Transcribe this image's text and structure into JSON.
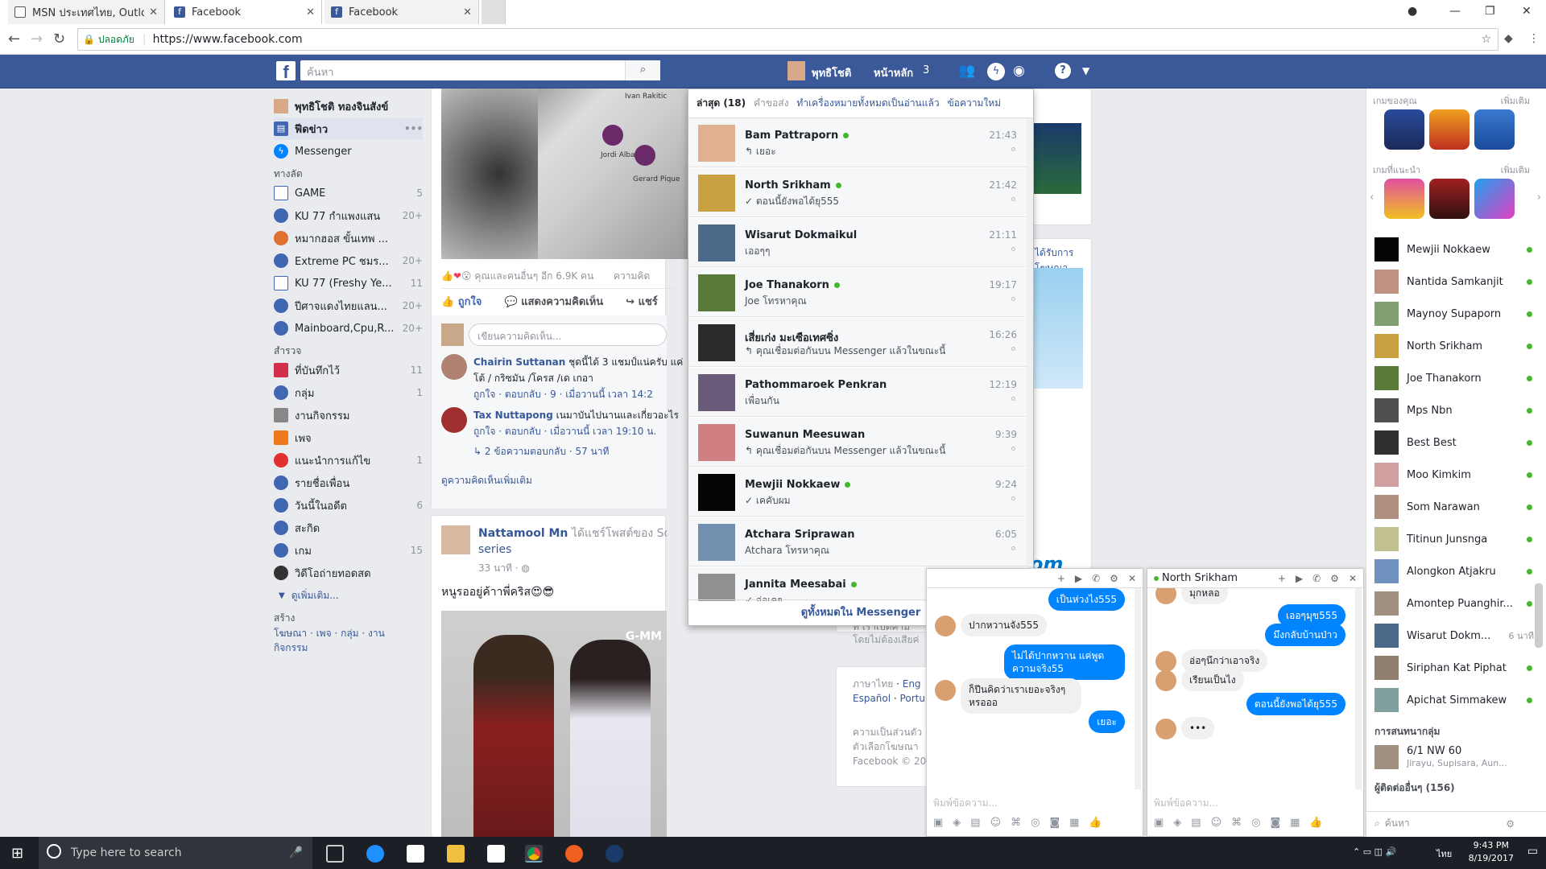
{
  "browser": {
    "tabs": [
      {
        "title": "MSN ประเทศไทย, Outlook",
        "active": false
      },
      {
        "title": "Facebook",
        "active": true
      },
      {
        "title": "Facebook",
        "active": false
      }
    ],
    "secure_label": "ปลอดภัย",
    "url": "https://www.facebook.com"
  },
  "fbbar": {
    "search_placeholder": "ค้นหา",
    "user_short": "พุทธิโชติ",
    "home_label": "หน้าหลัก",
    "home_count": "3"
  },
  "leftnav": {
    "profile": "พุทธิโชติ ทองจินสังข์",
    "feed": "ฟีดข่าว",
    "messenger": "Messenger",
    "shortcuts_title": "ทางลัด",
    "shortcuts": [
      {
        "label": "GAME",
        "count": "5"
      },
      {
        "label": "KU 77 กำแพงแสน",
        "count": "20+"
      },
      {
        "label": "หมากฮอส ขั้นเทพ ...",
        "count": ""
      },
      {
        "label": "Extreme PC ชมร...",
        "count": "20+"
      },
      {
        "label": "KU 77 (Freshy Ye...",
        "count": "11"
      },
      {
        "label": "ปีศาจแดงไทยแลน...",
        "count": "20+"
      },
      {
        "label": "Mainboard,Cpu,R...",
        "count": "20+"
      }
    ],
    "explore_title": "สำรวจ",
    "explore": [
      {
        "label": "ที่บันทึกไว้",
        "count": "11"
      },
      {
        "label": "กลุ่ม",
        "count": "1"
      },
      {
        "label": "งานกิจกรรม",
        "count": ""
      },
      {
        "label": "เพจ",
        "count": ""
      },
      {
        "label": "แนะนำการแก้ไข",
        "count": "1"
      },
      {
        "label": "รายชื่อเพื่อน",
        "count": ""
      },
      {
        "label": "วันนี้ในอดีต",
        "count": "6"
      },
      {
        "label": "สะกิด",
        "count": ""
      },
      {
        "label": "เกม",
        "count": "15"
      },
      {
        "label": "วิดีโอถ่ายทอดสด",
        "count": ""
      }
    ],
    "see_more": "ดูเพิ่มเติม...",
    "create_title": "สร้าง",
    "create_links": "โฆษณา · เพจ · กลุ่ม · งาน กิจกรรม"
  },
  "post1": {
    "reactions_text": "คุณและคนอื่นๆ อีก 6.9K คน",
    "comment_word": "ความคิด",
    "like": "ถูกใจ",
    "comment": "แสดงความคิดเห็น",
    "share": "แชร์",
    "write_comment": "เขียนความคิดเห็น...",
    "comments": [
      {
        "name": "Chairin Suttanan",
        "text": "ชุดนี้ได้ 3 แชมป์แน่ครับ แค่",
        "text2": "โต้ / กริซมัน /โครส /เด เกอา",
        "meta": "ถูกใจ · ตอบกลับ · 9 · เมื่อวานนี้ เวลา 14:2"
      },
      {
        "name": "Tax Nuttapong",
        "text": "เนมาบันไปนานและเกี่ยวอะไร",
        "meta": "ถูกใจ · ตอบกลับ · เมื่อวานนี้ เวลา 19:10 น."
      }
    ],
    "replies": "2 ข้อความตอบกลับ · 57 นาที",
    "more_comments": "ดูความคิดเห็นเพิ่มเติม",
    "players": [
      "Ivan Rakitic",
      "Jordi Alba",
      "Gerard Pique"
    ]
  },
  "post2": {
    "author": "Nattamool Mn",
    "action": "ได้แชร์โพสต์ของ Sotu",
    "action2": "series",
    "time": "33 นาที",
    "text": "หนูรออยู่ค้าาพี่คริส😍😎",
    "watermark": "G-MM"
  },
  "messenger": {
    "recent": "ล่าสุด (18)",
    "requests": "คำขอส่ง",
    "mark_read": "ทำเครื่องหมายทั้งหมดเป็นอ่านแล้ว",
    "new_msg": "ข้อความใหม่",
    "see_all": "ดูทั้งหมดใน Messenger",
    "threads": [
      {
        "name": "Bam Pattraporn",
        "online": true,
        "snippet": "↰ เยอะ",
        "time": "21:43",
        "color": "#e0b090"
      },
      {
        "name": "North Srikham",
        "online": true,
        "snippet": "✓ ตอนนี้ยังพอได้ยุ555",
        "time": "21:42",
        "color": "#c8a040"
      },
      {
        "name": "Wisarut Dokmaikul",
        "online": false,
        "snippet": "เออๆๆ",
        "time": "21:11",
        "color": "#4a6a8a"
      },
      {
        "name": "Joe Thanakorn",
        "online": true,
        "snippet": "Joe โทรหาคุณ",
        "time": "19:17",
        "color": "#5a7a3a"
      },
      {
        "name": "เสี่ยเก่ง มะเซือเทศซิ่ง",
        "online": false,
        "snippet": "↰ คุณเชื่อมต่อกันบน Messenger แล้วในขณะนี้",
        "time": "16:26",
        "color": "#2a2a2a"
      },
      {
        "name": "Pathommaroek Penkran",
        "online": false,
        "snippet": "เพื่อนกัน",
        "time": "12:19",
        "color": "#6a5a7a"
      },
      {
        "name": "Suwanun Meesuwan",
        "online": false,
        "snippet": "↰ คุณเชื่อมต่อกันบน Messenger แล้วในขณะนี้",
        "time": "9:39",
        "color": "#d08080"
      },
      {
        "name": "Mewjii Nokkaew",
        "online": true,
        "snippet": "✓ เคคับผม",
        "time": "9:24",
        "color": "#050505"
      },
      {
        "name": "Atchara Sriprawan",
        "online": false,
        "snippet": "Atchara โทรหาคุณ",
        "time": "6:05",
        "color": "#7090b0"
      },
      {
        "name": "Jannita Meesabai",
        "online": true,
        "snippet": "✓ อ่อเคๆ",
        "time": "ศ.",
        "color": "#909090"
      }
    ]
  },
  "rightcol": {
    "sponsored": "ได้รับการโฆษณา",
    "lang_th": "ภาษาไทย",
    "lang_en": "Eng",
    "lang_es": "Español",
    "lang_pt": "Portu",
    "fb_copy": "Facebook © 20",
    "misc1": "ความเป็นส่วนตัว",
    "misc2": "ตัวเลือกโฆษณา",
    "ad1": "ที่ เราเปิดคาม",
    "ad2": "โดยไม่ต้องเสียค่"
  },
  "rside": {
    "your_games": "เกมของคุณ",
    "see_more": "เพิ่มเติม",
    "suggested_games": "เกมที่แนะนำ",
    "contacts": [
      {
        "name": "Mewjii Nokkaew",
        "extra": "",
        "color": "#050505"
      },
      {
        "name": "Nantida Samkanjit",
        "extra": "",
        "color": "#c09080"
      },
      {
        "name": "Maynoy Supaporn",
        "extra": "",
        "color": "#80a070"
      },
      {
        "name": "North Srikham",
        "extra": "",
        "color": "#c8a040"
      },
      {
        "name": "Joe Thanakorn",
        "extra": "",
        "color": "#5a7a3a"
      },
      {
        "name": "Mps Nbn",
        "extra": "",
        "color": "#505050"
      },
      {
        "name": "Best Best",
        "extra": "",
        "color": "#303030"
      },
      {
        "name": "Moo Kimkim",
        "extra": "",
        "color": "#d0a0a0"
      },
      {
        "name": "Som Narawan",
        "extra": "",
        "color": "#b09080"
      },
      {
        "name": "Titinun Junsnga",
        "extra": "",
        "color": "#c0c090"
      },
      {
        "name": "Alongkon Atjakru",
        "extra": "",
        "color": "#7090c0"
      },
      {
        "name": "Amontep Puanghir...",
        "extra": "",
        "color": "#a09080"
      },
      {
        "name": "Wisarut Dokm...",
        "extra": "6 นาที",
        "color": "#4a6a8a"
      },
      {
        "name": "Siriphan Kat Piphat",
        "extra": "",
        "color": "#908070"
      },
      {
        "name": "Apichat Simmakew",
        "extra": "",
        "color": "#80a0a0"
      }
    ],
    "group_title": "การสนทนากลุ่ม",
    "group_name": "6/1 NW 60",
    "group_members": "Jirayu, Supisara, Aun...",
    "others": "ผู้ติดต่ออื่นๆ (156)",
    "search": "ค้นหา"
  },
  "chat1": {
    "bubbles": [
      {
        "who": "me",
        "text": "เป็นห่วงไง555"
      },
      {
        "who": "them",
        "text": "ปากหวานจัง555"
      },
      {
        "who": "me",
        "text": "ไม่ได้ปากหวาน แค่พูดความจริง55"
      },
      {
        "who": "them",
        "text": "ก็ปีนคิดว่าเราเยอะจริงๆหรอออ"
      },
      {
        "who": "me",
        "text": "เยอะ"
      }
    ],
    "input": "พิมพ์ข้อความ..."
  },
  "chat2": {
    "title": "North Srikham",
    "bubbles": [
      {
        "who": "them",
        "text": "มุกหลอ"
      },
      {
        "who": "me",
        "text": "เออๆมุข555"
      },
      {
        "who": "me",
        "text": "มึงกลับบ้านป่าว"
      },
      {
        "who": "them",
        "text": "อ่อๆนึกว่าเอาจริง"
      },
      {
        "who": "them",
        "text": "เรียนเป็นไง"
      },
      {
        "who": "me",
        "text": "ตอนนี้ยังพอได้ยุ555"
      },
      {
        "who": "them",
        "text": "•••"
      }
    ],
    "input": "พิมพ์ข้อความ..."
  },
  "taskbar": {
    "search": "Type here to search",
    "time": "9:43 PM",
    "date": "8/19/2017",
    "lang": "ไทย"
  }
}
